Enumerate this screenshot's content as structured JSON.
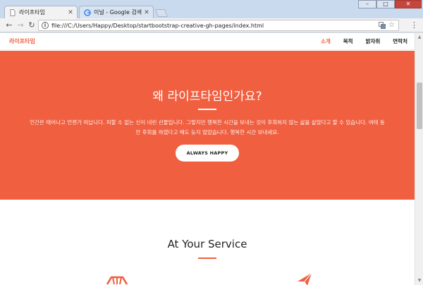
{
  "browser": {
    "tabs": [
      {
        "title": "라이프타임",
        "icon": "page-icon"
      },
      {
        "title": "이널 - Google 검색",
        "icon": "google-icon"
      }
    ],
    "window_controls": {
      "minimize": "–",
      "maximize": "□",
      "close": "✕"
    },
    "address": "file:///C:/Users/Happy/Desktop/startbootstrap-creative-gh-pages/index.html"
  },
  "page": {
    "brand": "라이프타임",
    "nav": [
      {
        "label": "소개",
        "active": true
      },
      {
        "label": "목적",
        "active": false
      },
      {
        "label": "밝자취",
        "active": false
      },
      {
        "label": "연락처",
        "active": false
      }
    ],
    "hero": {
      "title": "왜 라이프타임인가요?",
      "text": "인간은 태어나고 언젠가 떠납니다. 피할 수 없는 신이 내린 선물입니다. 그렇지만 행복한 시간을 보내는 것이 후회하지 않는 삶을 살았다고 할 수 있습니다. 여태 동안 후회를 하였다고 해도 늦지 않았습니다. 행복한 시간 보내세요.",
      "button": "ALWAYS HAPPY"
    },
    "service": {
      "title": "At Your Service"
    }
  },
  "colors": {
    "accent": "#f05f40"
  }
}
